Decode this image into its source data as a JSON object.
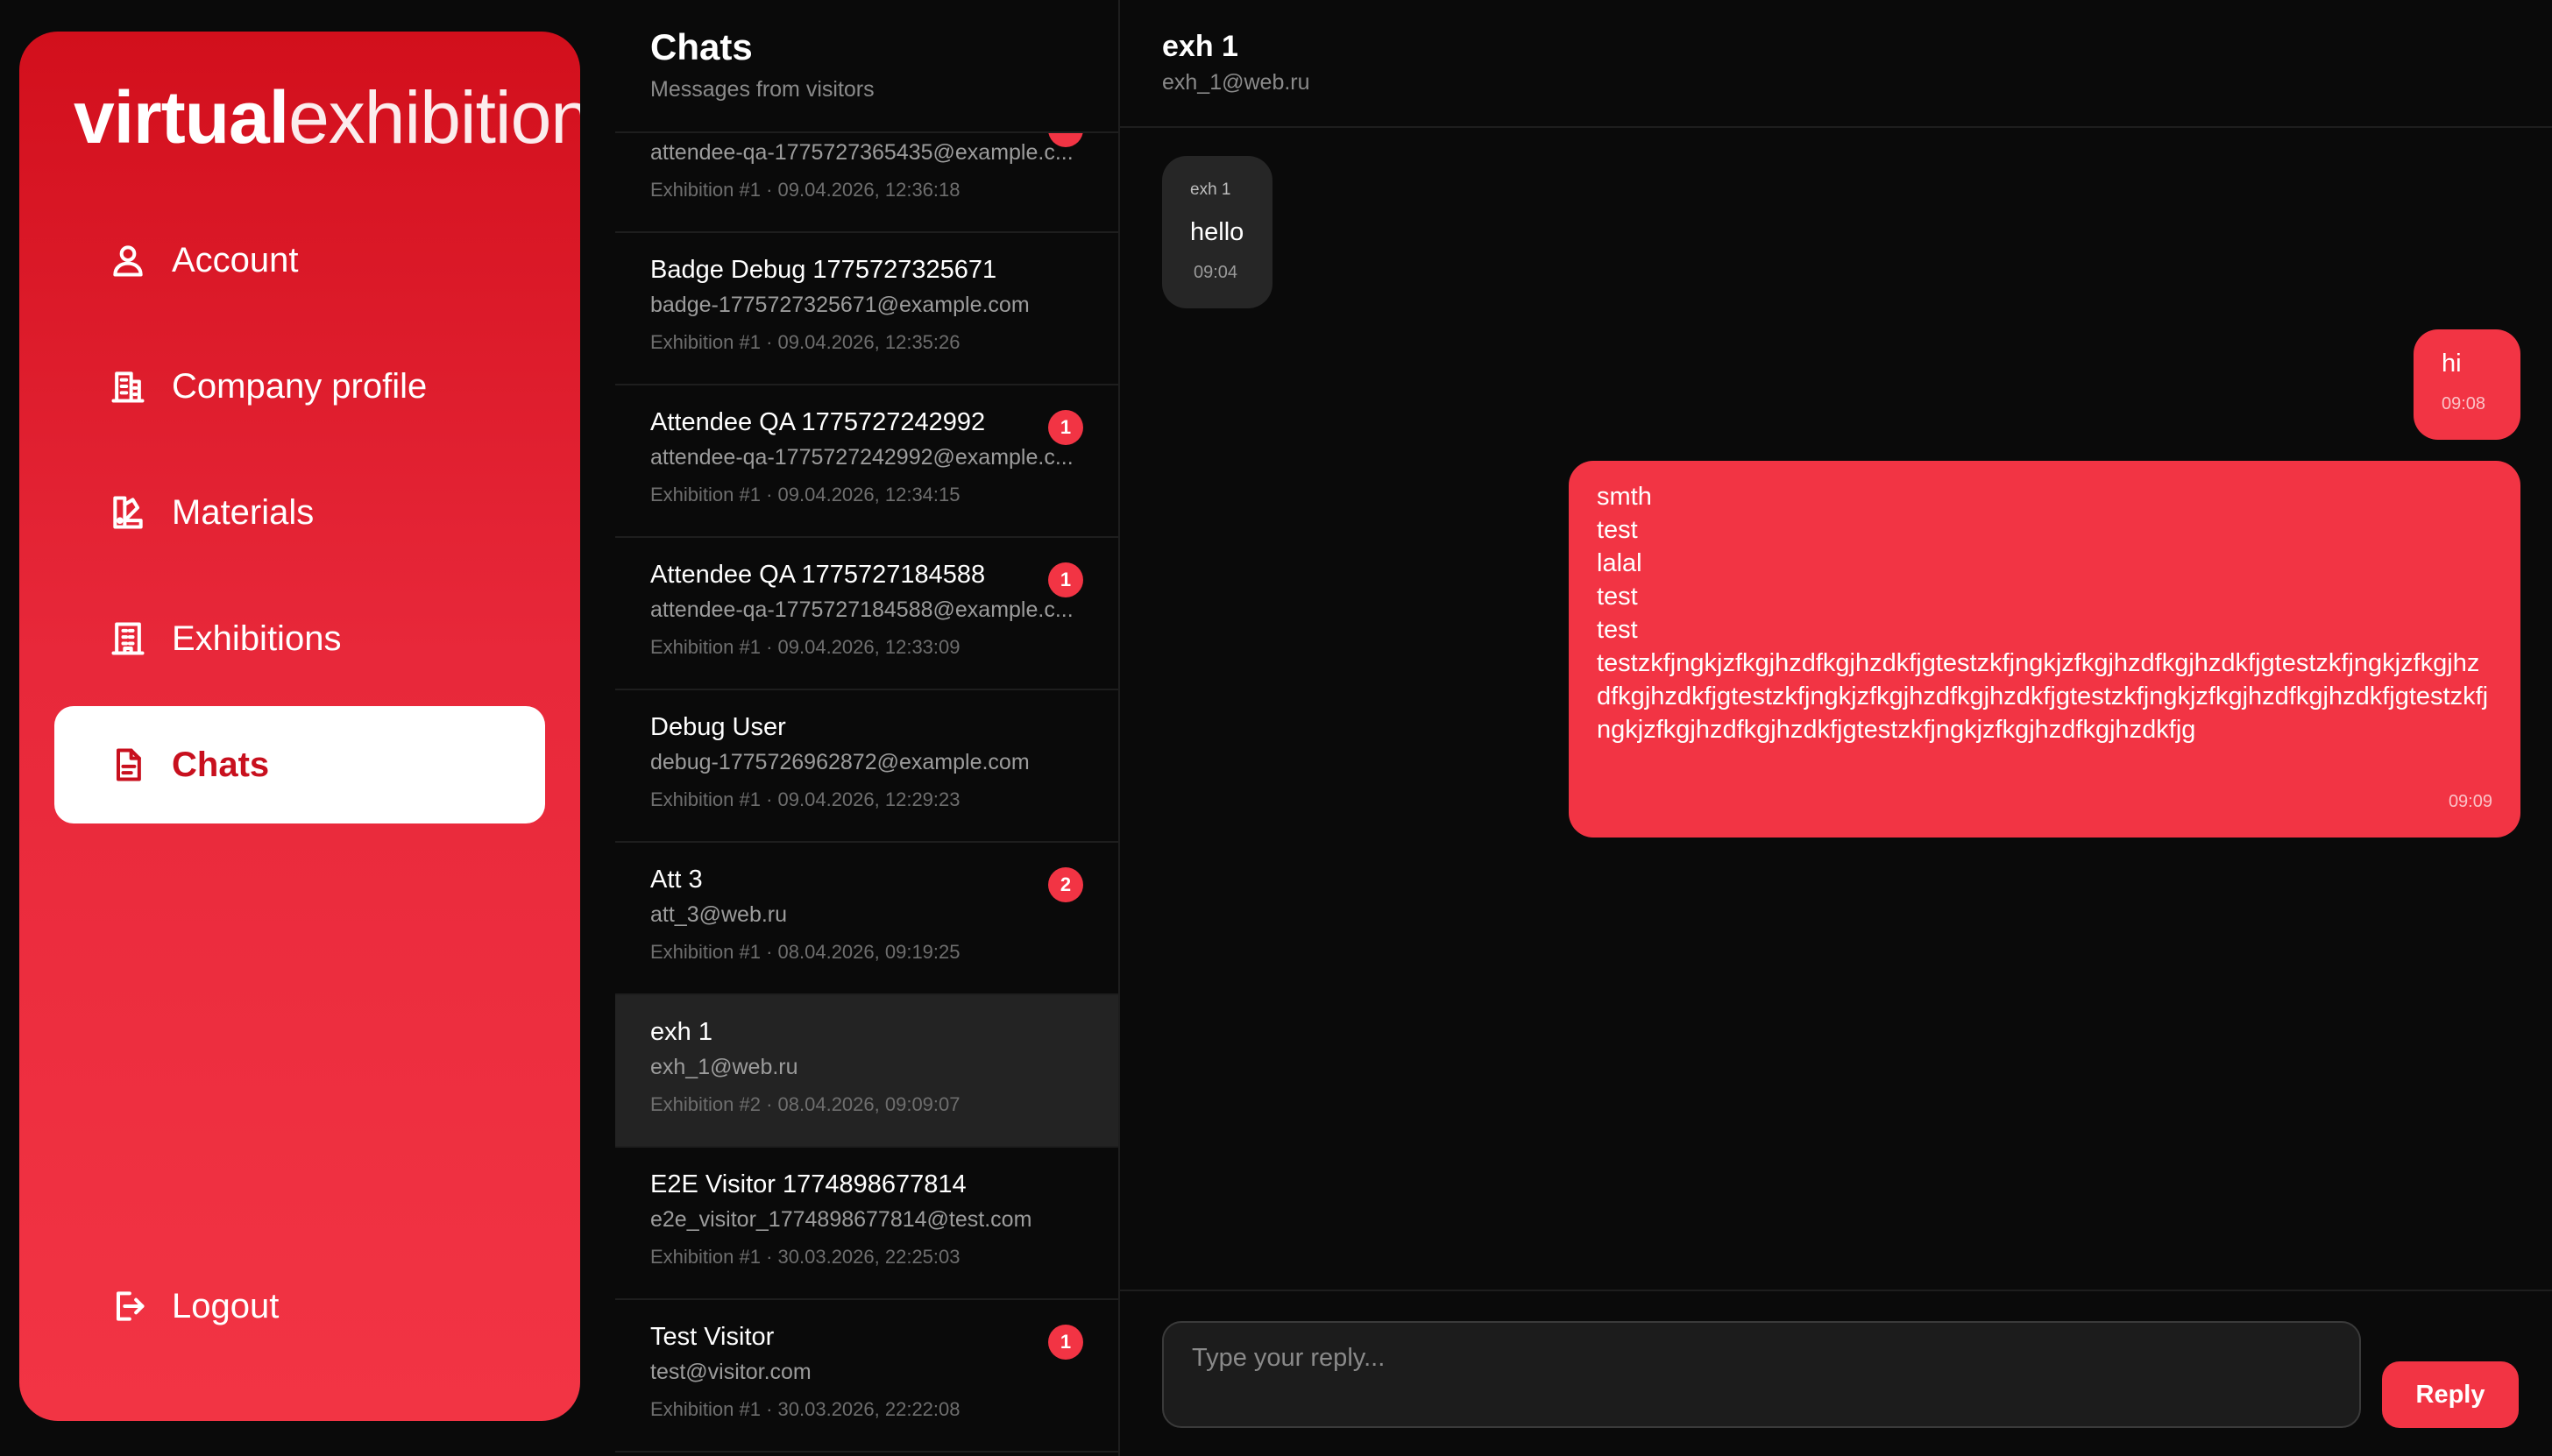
{
  "sidebar": {
    "logo_bold": "virtual",
    "logo_light": "exhibitions",
    "items": [
      {
        "label": "Account"
      },
      {
        "label": "Company profile"
      },
      {
        "label": "Materials"
      },
      {
        "label": "Exhibitions"
      },
      {
        "label": "Chats"
      }
    ],
    "logout_label": "Logout"
  },
  "chat_list": {
    "title": "Chats",
    "subtitle": "Messages from visitors",
    "items": [
      {
        "name": "",
        "email": "attendee-qa-1775727365435@example.c...",
        "meta": "Exhibition #1 · 09.04.2026, 12:36:18",
        "badge": ""
      },
      {
        "name": "Badge Debug 1775727325671",
        "email": "badge-1775727325671@example.com",
        "meta": "Exhibition #1 · 09.04.2026, 12:35:26",
        "badge": ""
      },
      {
        "name": "Attendee QA 1775727242992",
        "email": "attendee-qa-1775727242992@example.c...",
        "meta": "Exhibition #1 · 09.04.2026, 12:34:15",
        "badge": "1"
      },
      {
        "name": "Attendee QA 1775727184588",
        "email": "attendee-qa-1775727184588@example.c...",
        "meta": "Exhibition #1 · 09.04.2026, 12:33:09",
        "badge": "1"
      },
      {
        "name": "Debug User",
        "email": "debug-1775726962872@example.com",
        "meta": "Exhibition #1 · 09.04.2026, 12:29:23",
        "badge": ""
      },
      {
        "name": "Att 3",
        "email": "att_3@web.ru",
        "meta": "Exhibition #1 · 08.04.2026, 09:19:25",
        "badge": "2"
      },
      {
        "name": "exh 1",
        "email": "exh_1@web.ru",
        "meta": "Exhibition #2 · 08.04.2026, 09:09:07",
        "badge": ""
      },
      {
        "name": "E2E Visitor 1774898677814",
        "email": "e2e_visitor_1774898677814@test.com",
        "meta": "Exhibition #1 · 30.03.2026, 22:25:03",
        "badge": ""
      },
      {
        "name": "Test Visitor",
        "email": "test@visitor.com",
        "meta": "Exhibition #1 · 30.03.2026, 22:22:08",
        "badge": "1"
      }
    ]
  },
  "conversation": {
    "name": "exh 1",
    "email": "exh_1@web.ru",
    "messages": [
      {
        "sender": "exh 1",
        "text": "hello",
        "time": "09:04"
      },
      {
        "sender": "",
        "text": "hi",
        "time": "09:08"
      },
      {
        "sender": "",
        "text": "smth\ntest\nlalal\ntest\ntest\ntestzkfjngkjzfkgjhzdfkgjhzdkfjgtestzkfjngkjzfkgjhzdfkgjhzdkfjgtestzkfjngkjzfkgjhzdfkgjhzdkfjgtestzkfjngkjzfkgjhzdfkgjhzdkfjgtestzkfjngkjzfkgjhzdfkgjhzdkfjgtestzkfjngkjzfkgjhzdfkgjhzdkfjgtestzkfjngkjzfkgjhzdfkgjhzdkfjg",
        "time": "09:09"
      }
    ]
  },
  "composer": {
    "placeholder": "Type your reply...",
    "button_label": "Reply"
  },
  "colors": {
    "accent": "#f23444",
    "sidebar_top": "#d20f1c",
    "background": "#0a0a0a",
    "incoming_bubble": "#262626"
  }
}
